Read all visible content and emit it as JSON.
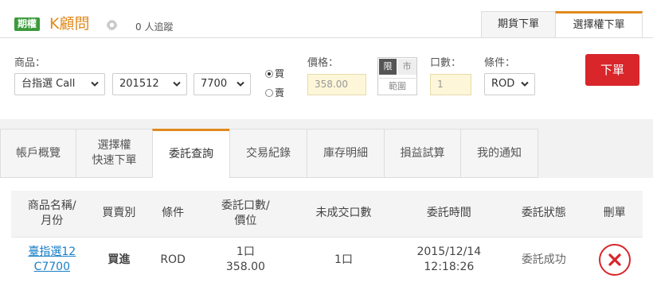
{
  "header": {
    "badge": "期權",
    "title": "K顧問",
    "followers": "0 人追蹤",
    "tabs": [
      "期貨下單",
      "選擇權下單"
    ]
  },
  "form": {
    "product_label": "商品：",
    "product": "台指選 Call",
    "month": "201512",
    "strike": "7700",
    "buy_label": "買",
    "sell_label": "賣",
    "price_label": "價格：",
    "price": "358.00",
    "price_modes": {
      "limit": "限",
      "market": "市",
      "range": "範圍"
    },
    "qty_label": "口數：",
    "qty": "1",
    "cond_label": "條件：",
    "cond": "ROD",
    "submit": "下單"
  },
  "tabs": [
    {
      "label": "帳戶概覽"
    },
    {
      "label": "選擇權\n快速下單"
    },
    {
      "label": "委託查詢",
      "active": true
    },
    {
      "label": "交易紀錄"
    },
    {
      "label": "庫存明細"
    },
    {
      "label": "損益試算"
    },
    {
      "label": "我的通知"
    }
  ],
  "table": {
    "headers": [
      "商品名稱/\n月份",
      "買賣別",
      "條件",
      "委託口數/\n價位",
      "未成交口數",
      "委託時間",
      "委託狀態",
      "刪單"
    ],
    "rows": [
      {
        "product": "臺指選12\nC7700",
        "side": "買進",
        "cond": "ROD",
        "qty_price": "1口\n358.00",
        "unfilled": "1口",
        "time": "2015/12/14\n12:18:26",
        "status": "委託成功"
      }
    ]
  },
  "colors": {
    "accent": "#e08a1e",
    "red": "#d8262b",
    "green_badge": "#3c9a3c",
    "link": "#1a7fc7"
  }
}
